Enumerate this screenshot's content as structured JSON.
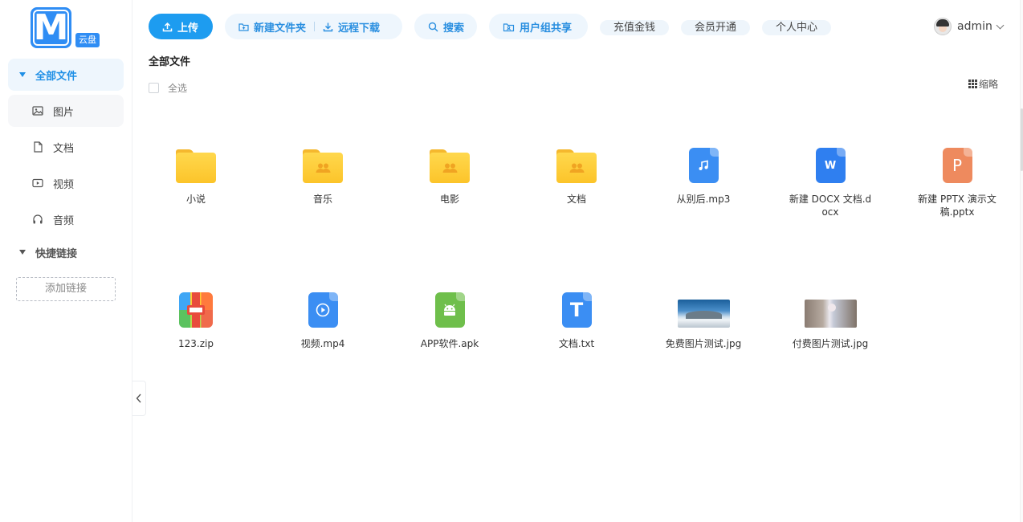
{
  "logo": {
    "letter": "M",
    "badge": "云盘"
  },
  "sidebar": {
    "all_files": "全部文件",
    "categories": [
      "图片",
      "文档",
      "视频",
      "音频"
    ],
    "quick_links": "快捷链接",
    "add_link": "添加链接"
  },
  "toolbar": {
    "upload": "上传",
    "new_folder": "新建文件夹",
    "remote_download": "远程下载",
    "search": "搜索",
    "group_share": "用户组共享",
    "recharge": "充值金钱",
    "vip": "会员开通",
    "profile": "个人中心"
  },
  "user": {
    "name": "admin"
  },
  "breadcrumb": "全部文件",
  "select_all": "全选",
  "view_mode": "缩略",
  "colors": {
    "primary": "#1d9cf0",
    "accent_bg": "#eef6fd",
    "folder": "#fcc42a"
  },
  "files": [
    {
      "name": "小说",
      "type": "folder",
      "icon": "folder-icon"
    },
    {
      "name": "音乐",
      "type": "shared-folder",
      "icon": "shared-folder-icon"
    },
    {
      "name": "电影",
      "type": "shared-folder",
      "icon": "shared-folder-icon"
    },
    {
      "name": "文档",
      "type": "shared-folder",
      "icon": "shared-folder-icon"
    },
    {
      "name": "从别后.mp3",
      "type": "audio",
      "icon": "music-note-icon"
    },
    {
      "name": "新建 DOCX 文档.docx",
      "type": "word",
      "icon": "word-icon",
      "glyph": "W"
    },
    {
      "name": "新建 PPTX 演示文稿.pptx",
      "type": "ppt",
      "icon": "powerpoint-icon",
      "glyph": "P"
    },
    {
      "name": "123.zip",
      "type": "zip",
      "icon": "archive-icon"
    },
    {
      "name": "视频.mp4",
      "type": "video",
      "icon": "video-play-icon"
    },
    {
      "name": "APP软件.apk",
      "type": "apk",
      "icon": "android-icon"
    },
    {
      "name": "文档.txt",
      "type": "txt",
      "icon": "text-file-icon",
      "glyph": "T"
    },
    {
      "name": "免费图片测试.jpg",
      "type": "image",
      "icon": "image-thumbnail"
    },
    {
      "name": "付费图片测试.jpg",
      "type": "image",
      "icon": "image-thumbnail"
    }
  ]
}
